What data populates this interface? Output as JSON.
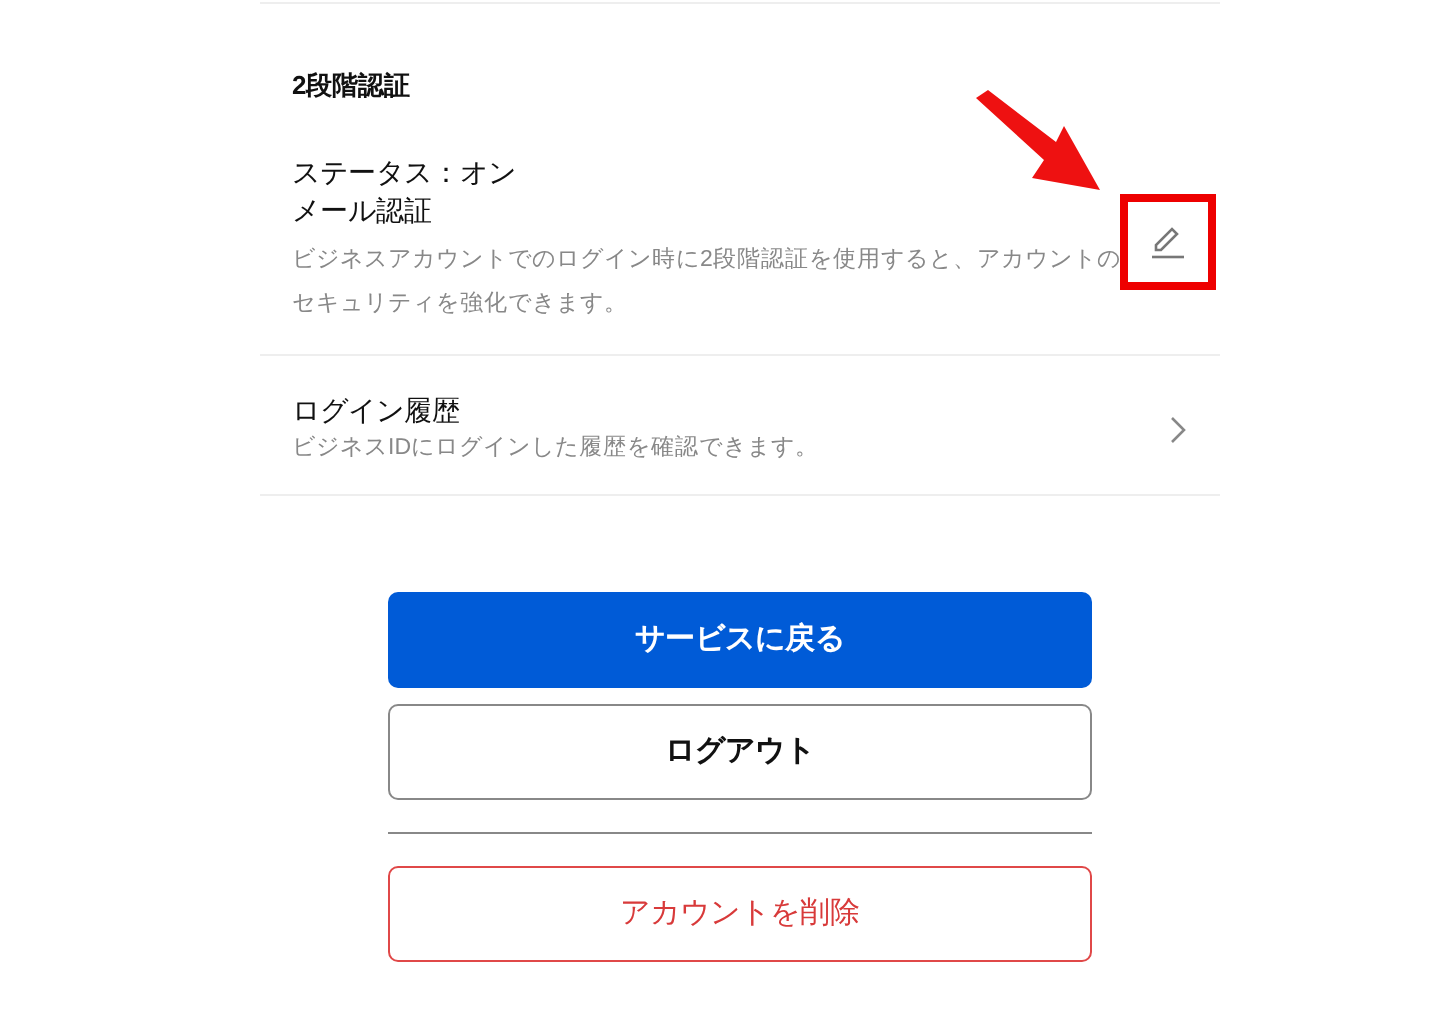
{
  "two_factor": {
    "title": "2段階認証",
    "status": "ステータス：オン",
    "method": "メール認証",
    "description": "ビジネスアカウントでのログイン時に2段階認証を使用すると、アカウントのセキュリティを強化できます。",
    "edit_highlighted": true
  },
  "login_history": {
    "title": "ログイン履歴",
    "description": "ビジネスIDにログインした履歴を確認できます。"
  },
  "buttons": [
    {
      "label": "サービスに戻る",
      "kind": "primary"
    },
    {
      "label": "ログアウト",
      "kind": "secondary"
    },
    {
      "label": "アカウントを削除",
      "kind": "danger"
    }
  ]
}
